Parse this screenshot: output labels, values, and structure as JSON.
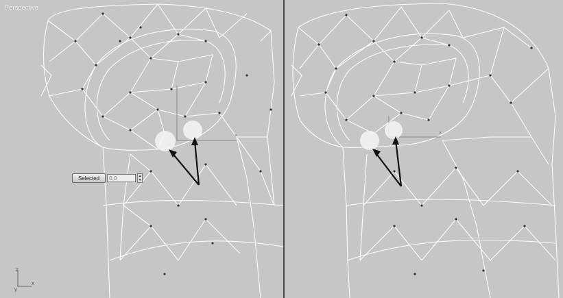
{
  "viewports": {
    "left": {
      "label": "Perspective"
    },
    "right": {
      "label": ""
    }
  },
  "spinner": {
    "button_label": "Selected",
    "value": "0.0",
    "up_arrow": "▲",
    "down_arrow": "▼"
  },
  "axis_triad": {
    "z": "z",
    "y": "y",
    "x": "x"
  },
  "colors": {
    "viewport_bg": "#c6c6c6",
    "mesh_lines": "#ffffff",
    "vertices": "#333333",
    "arrows": "#111111",
    "highlight": "#f4f4f4"
  }
}
